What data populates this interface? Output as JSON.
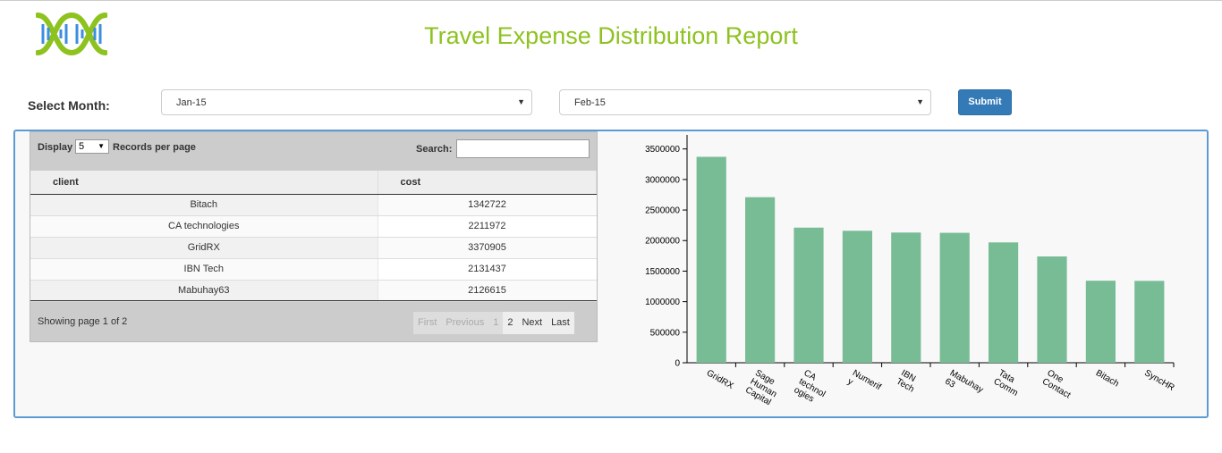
{
  "header": {
    "title": "Travel Expense Distribution Report"
  },
  "filters": {
    "month_label": "Select Month:",
    "from_month": "Jan-15",
    "to_month": "Feb-15",
    "submit_label": "Submit"
  },
  "table": {
    "display_label": "Display",
    "page_size": "5",
    "records_label": "Records per page",
    "search_label": "Search:",
    "columns": [
      "client",
      "cost"
    ],
    "rows": [
      {
        "client": "Bitach",
        "cost": "1342722"
      },
      {
        "client": "CA technologies",
        "cost": "2211972"
      },
      {
        "client": "GridRX",
        "cost": "3370905"
      },
      {
        "client": "IBN Tech",
        "cost": "2131437"
      },
      {
        "client": "Mabuhay63",
        "cost": "2126615"
      }
    ],
    "showing": "Showing page 1 of 2",
    "pager": {
      "first": "First",
      "previous": "Previous",
      "page1": "1",
      "page2": "2",
      "next": "Next",
      "last": "Last"
    }
  },
  "colors": {
    "title": "#8dc21f",
    "bar": "#78bc96",
    "panel_border": "#5b9bd5",
    "submit": "#337ab7"
  },
  "chart_data": {
    "type": "bar",
    "categories": [
      [
        "GridRX"
      ],
      [
        "Sage",
        "Human",
        "Capital"
      ],
      [
        "CA",
        "technol",
        "ogies"
      ],
      [
        "Numerif",
        "y"
      ],
      [
        "IBN",
        "Tech"
      ],
      [
        "Mabuhay",
        "63"
      ],
      [
        "Tata",
        "Comm"
      ],
      [
        "One",
        "Contact"
      ],
      [
        "Bitach"
      ],
      [
        "SyncHR"
      ]
    ],
    "values": [
      3370905,
      2710000,
      2211972,
      2160000,
      2131437,
      2126615,
      1970000,
      1740000,
      1342722,
      1340000
    ],
    "ylim": [
      0,
      3700000
    ],
    "yticks": [
      0,
      500000,
      1000000,
      1500000,
      2000000,
      2500000,
      3000000,
      3500000
    ],
    "title": "",
    "xlabel": "",
    "ylabel": "",
    "grid": false,
    "legend": "none"
  }
}
